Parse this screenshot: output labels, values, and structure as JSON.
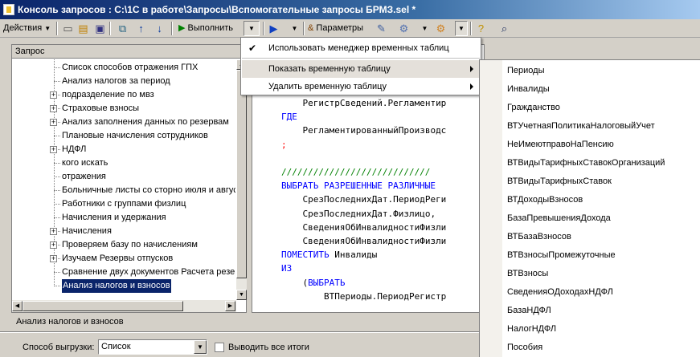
{
  "window": {
    "title": "Консоль запросов : C:\\1С в работе\\Запросы\\Вспомогательные запросы БРМЗ.sel *"
  },
  "toolbar": {
    "actions_label": "Действия",
    "execute_label": "Выполнить",
    "params_label": "Параметры"
  },
  "tree": {
    "header": "Запрос",
    "items": [
      {
        "label": "Список способов отражения ГПХ",
        "expandable": false
      },
      {
        "label": "Анализ налогов за период",
        "expandable": false
      },
      {
        "label": "подразделение по мвз",
        "expandable": true
      },
      {
        "label": "Страховые взносы",
        "expandable": true
      },
      {
        "label": "Анализ заполнения данных по резервам",
        "expandable": true
      },
      {
        "label": "Плановые начисления сотрудников",
        "expandable": false
      },
      {
        "label": "НДФЛ",
        "expandable": true
      },
      {
        "label": "кого искать",
        "expandable": false
      },
      {
        "label": "отражения",
        "expandable": false
      },
      {
        "label": "Больничные листы со сторно июля и августа",
        "expandable": false
      },
      {
        "label": "Работники с группами физлиц",
        "expandable": false
      },
      {
        "label": "Начисления и удержания",
        "expandable": false
      },
      {
        "label": "Начисления",
        "expandable": true
      },
      {
        "label": "Проверяем базу по начислениям",
        "expandable": true
      },
      {
        "label": "Изучаем Резервы отпусков",
        "expandable": true
      },
      {
        "label": "Сравнение двух документов Расчета резерво",
        "expandable": false
      },
      {
        "label": "Анализ налогов и взносов",
        "expandable": false,
        "selected": true
      }
    ]
  },
  "code": [
    {
      "indent": "    ",
      "parts": [
        {
          "cls": "tx",
          "text": "РегистрСведений.Регламентир"
        }
      ]
    },
    {
      "indent": "",
      "parts": [
        {
          "cls": "kw",
          "text": "ГДЕ"
        }
      ]
    },
    {
      "indent": "    ",
      "parts": [
        {
          "cls": "tx",
          "text": "РегламентированныйПроизводс"
        }
      ]
    },
    {
      "indent": "",
      "parts": [
        {
          "cls": "rd",
          "text": ";"
        }
      ]
    },
    {
      "indent": "",
      "parts": [
        {
          "cls": "tx",
          "text": ""
        }
      ]
    },
    {
      "indent": "",
      "parts": [
        {
          "cls": "cm",
          "text": "////////////////////////////"
        }
      ]
    },
    {
      "indent": "",
      "parts": [
        {
          "cls": "kw",
          "text": "ВЫБРАТЬ РАЗРЕШЕННЫЕ РАЗЛИЧНЫЕ"
        }
      ]
    },
    {
      "indent": "    ",
      "parts": [
        {
          "cls": "tx",
          "text": "СрезПоследнихДат.ПериодРеги"
        }
      ]
    },
    {
      "indent": "    ",
      "parts": [
        {
          "cls": "tx",
          "text": "СрезПоследнихДат.Физлицо,"
        }
      ]
    },
    {
      "indent": "    ",
      "parts": [
        {
          "cls": "tx",
          "text": "СведенияОбИнвалидностиФизли"
        }
      ]
    },
    {
      "indent": "    ",
      "parts": [
        {
          "cls": "tx",
          "text": "СведенияОбИнвалидностиФизли"
        }
      ]
    },
    {
      "indent": "",
      "parts": [
        {
          "cls": "kw",
          "text": "ПОМЕСТИТЬ "
        },
        {
          "cls": "tx",
          "text": "Инвалиды"
        }
      ]
    },
    {
      "indent": "",
      "parts": [
        {
          "cls": "kw",
          "text": "ИЗ"
        }
      ]
    },
    {
      "indent": "    ",
      "parts": [
        {
          "cls": "tx",
          "text": "("
        },
        {
          "cls": "kw",
          "text": "ВЫБРАТЬ"
        }
      ]
    },
    {
      "indent": "        ",
      "parts": [
        {
          "cls": "tx",
          "text": "ВТПериоды.ПериодРегистр"
        }
      ]
    }
  ],
  "status": {
    "selected_query": "Анализ налогов и взносов"
  },
  "footer": {
    "export_label": "Способ выгрузки:",
    "export_value": "Список",
    "totals_label": "Выводить все итоги",
    "totals_checked": false
  },
  "menu": {
    "items": [
      {
        "label": "Использовать менеджер временных таблиц",
        "checked": true,
        "submenu": false
      },
      {
        "label": "Показать временную таблицу",
        "checked": false,
        "submenu": true,
        "highlighted": true
      },
      {
        "label": "Удалить временную таблицу",
        "checked": false,
        "submenu": true
      }
    ]
  },
  "submenu": {
    "items": [
      "Периоды",
      "Инвалиды",
      "Гражданство",
      "ВТУчетнаяПолитикаНалоговыйУчет",
      "НеИмеютправоНаПенсию",
      "ВТВидыТарифныхСтавокОрганизаций",
      "ВТВидыТарифныхСтавок",
      "ВТДоходыВзносов",
      "БазаПревышенияДохода",
      "ВТБазаВзносов",
      "ВТВзносыПромежуточные",
      "ВТВзносы",
      "СведенияОДоходахНДФЛ",
      "БазаНДФЛ",
      "НалогНДФЛ",
      "Пособия"
    ]
  }
}
